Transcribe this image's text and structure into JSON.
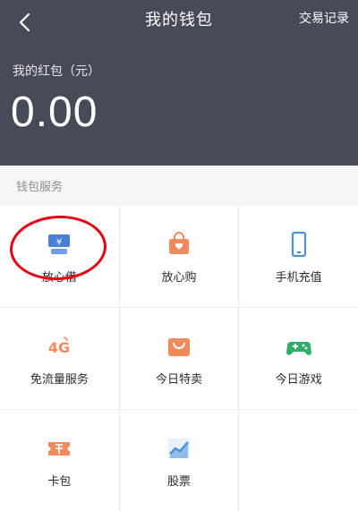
{
  "header": {
    "back_icon": "chevron-left-icon",
    "title": "我的钱包",
    "transactions_label": "交易记录",
    "wallet_label": "我的红包（元）",
    "balance": "0.00"
  },
  "services": {
    "section_title": "钱包服务",
    "items": [
      {
        "label": "放心借",
        "icon": "loan-icon",
        "color": "#4a7fd6"
      },
      {
        "label": "放心购",
        "icon": "shopping-bag-icon",
        "color": "#f08a5d"
      },
      {
        "label": "手机充值",
        "icon": "phone-icon",
        "color": "#4a90d9"
      },
      {
        "label": "免流量服务",
        "icon": "4g-icon",
        "color": "#f08a5d"
      },
      {
        "label": "今日特卖",
        "icon": "shopping-basket-icon",
        "color": "#f08a5d"
      },
      {
        "label": "今日游戏",
        "icon": "gamepad-icon",
        "color": "#2fae6a"
      },
      {
        "label": "卡包",
        "icon": "ticket-icon",
        "color": "#f08a5d"
      },
      {
        "label": "股票",
        "icon": "stock-chart-icon",
        "color": "#4a90d9"
      }
    ]
  },
  "annotation": {
    "highlight_color": "#e60012"
  }
}
